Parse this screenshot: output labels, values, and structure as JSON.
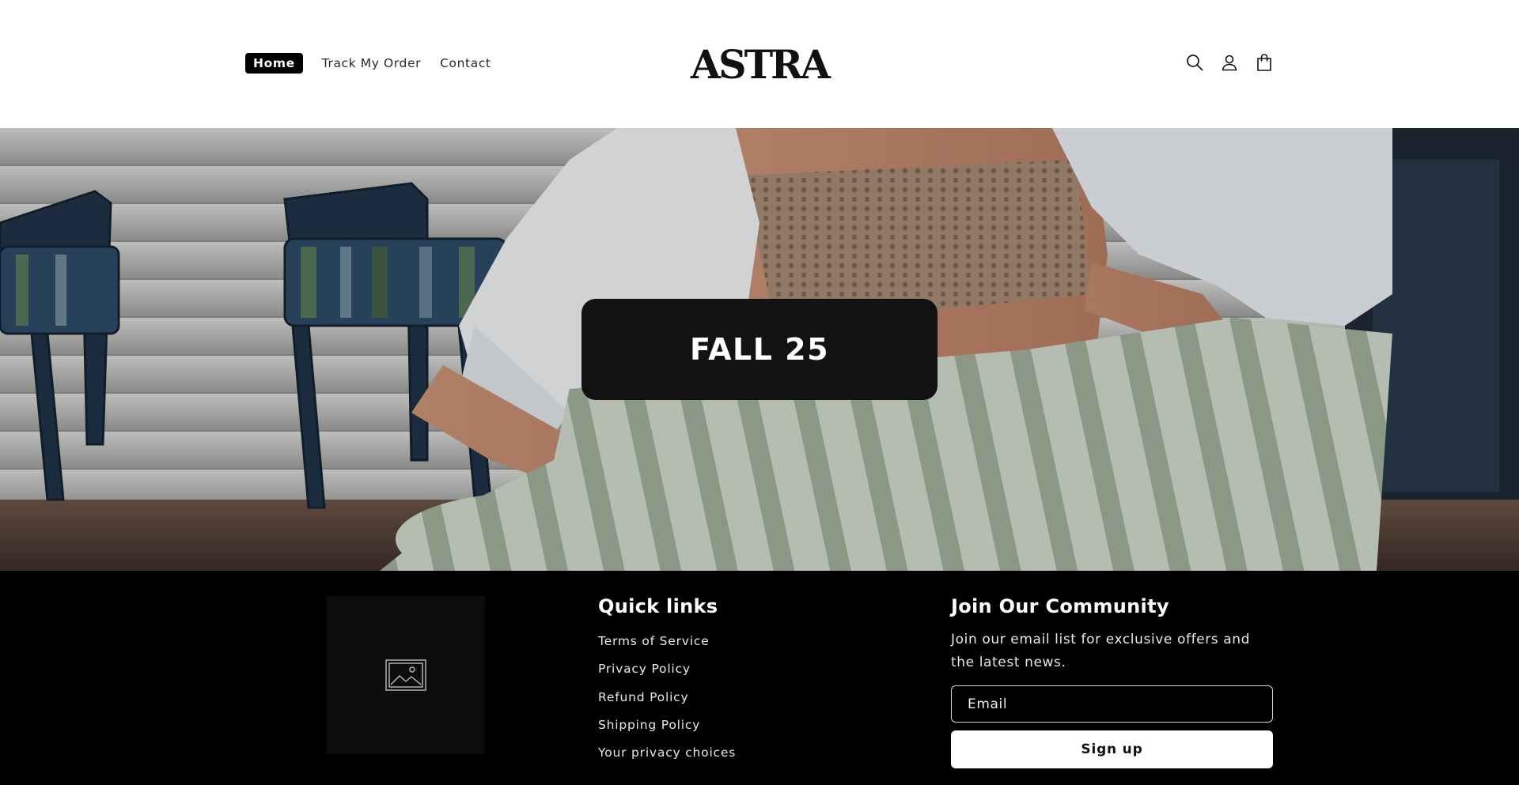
{
  "header": {
    "nav": [
      {
        "label": "Home",
        "active": true
      },
      {
        "label": "Track My Order",
        "active": false
      },
      {
        "label": "Contact",
        "active": false
      }
    ],
    "logo_text": "ASTRA",
    "icons": [
      "search-icon",
      "account-icon",
      "cart-icon"
    ]
  },
  "hero": {
    "title": "FALL 25"
  },
  "footer": {
    "logo_placeholder_icon": "image-placeholder-icon",
    "quick_links": {
      "heading": "Quick links",
      "items": [
        "Terms of Service",
        "Privacy Policy",
        "Refund Policy",
        "Shipping Policy",
        "Your privacy choices"
      ]
    },
    "community": {
      "heading": "Join Our Community",
      "text": "Join our email list for exclusive offers and the latest news.",
      "email_placeholder": "Email",
      "signup_label": "Sign up"
    }
  },
  "colors": {
    "header_bg": "#ffffff",
    "footer_bg": "#000000",
    "banner_bg": "#121212",
    "accent": "#000000"
  }
}
